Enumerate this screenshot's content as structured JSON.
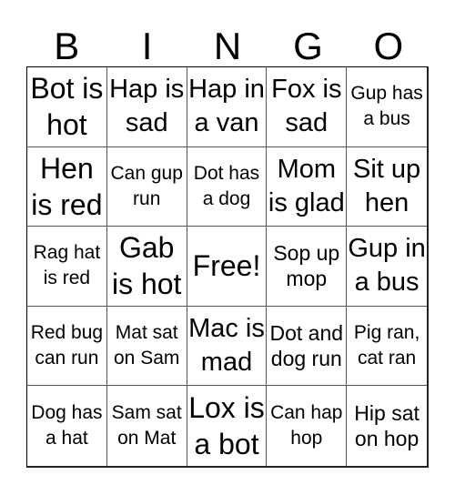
{
  "title_letters": [
    "B",
    "I",
    "N",
    "G",
    "O"
  ],
  "cells": [
    {
      "text": "Bot is hot",
      "size": "xl"
    },
    {
      "text": "Hap is sad",
      "size": "l"
    },
    {
      "text": "Hap in a van",
      "size": "l"
    },
    {
      "text": "Fox is sad",
      "size": "l"
    },
    {
      "text": "Gup has a bus",
      "size": "s"
    },
    {
      "text": "Hen is red",
      "size": "xl"
    },
    {
      "text": "Can gup run",
      "size": "s"
    },
    {
      "text": "Dot has a dog",
      "size": "s"
    },
    {
      "text": "Mom is glad",
      "size": "l"
    },
    {
      "text": "Sit up hen",
      "size": "l"
    },
    {
      "text": "Rag hat is red",
      "size": "s"
    },
    {
      "text": "Gab is hot",
      "size": "xl"
    },
    {
      "text": "Free!",
      "size": "xl"
    },
    {
      "text": "Sop up mop",
      "size": "m"
    },
    {
      "text": "Gup in a bus",
      "size": "l"
    },
    {
      "text": "Red bug can run",
      "size": "s"
    },
    {
      "text": "Mat sat on Sam",
      "size": "s"
    },
    {
      "text": "Mac is mad",
      "size": "l"
    },
    {
      "text": "Dot and dog run",
      "size": "m"
    },
    {
      "text": "Pig ran, cat ran",
      "size": "s"
    },
    {
      "text": "Dog has a hat",
      "size": "s"
    },
    {
      "text": "Sam sat on Mat",
      "size": "s"
    },
    {
      "text": "Lox is a bot",
      "size": "xl"
    },
    {
      "text": "Can hap hop",
      "size": "s"
    },
    {
      "text": "Hip sat on hop",
      "size": "m"
    }
  ]
}
